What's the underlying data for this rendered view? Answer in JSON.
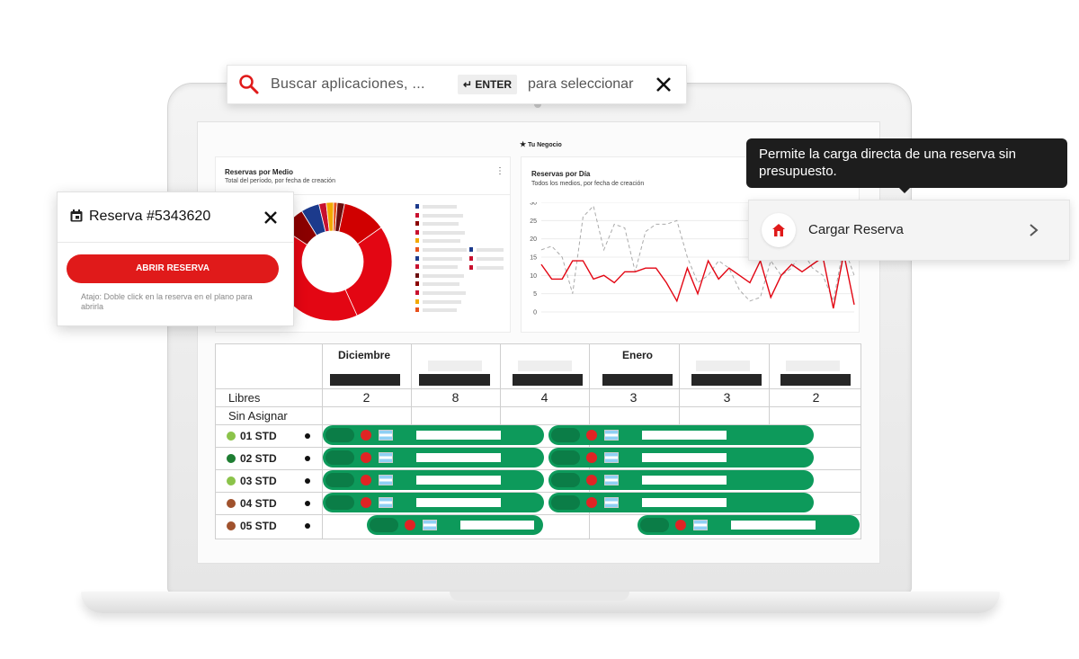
{
  "search": {
    "placeholder": "Buscar aplicaciones, ...",
    "enter_label": "ENTER",
    "hint": "para seleccionar"
  },
  "dashboard": {
    "section_title": "Tu Negocio",
    "card1": {
      "title": "Reservas por Medio",
      "subtitle": "Total del período, por fecha de creación"
    },
    "card2": {
      "title": "Reservas por Día",
      "subtitle": "Todos los medios, por fecha de creación"
    }
  },
  "chart_data": [
    {
      "type": "pie",
      "title": "Reservas por Medio",
      "values": [
        5,
        2,
        2,
        1,
        2,
        12,
        28,
        41,
        7
      ],
      "colors": [
        "#1c3a8c",
        "#c8102e",
        "#f2a900",
        "#e8501c",
        "#6b0d0d",
        "#d00000",
        "#e30613",
        "#e30613",
        "#8b0000"
      ]
    },
    {
      "type": "line",
      "title": "Reservas por Día",
      "ylim": [
        0,
        30
      ],
      "yticks": [
        0,
        5,
        10,
        15,
        20,
        25,
        30
      ],
      "series": [
        {
          "values": [
            13,
            9,
            9,
            14,
            14,
            9,
            10,
            8,
            11,
            11,
            12,
            12,
            8,
            3,
            12,
            5,
            14,
            9,
            12,
            10,
            8,
            14,
            4,
            10,
            13,
            11,
            13,
            15,
            1,
            16,
            2
          ],
          "color": "#e30613"
        },
        {
          "values": [
            17,
            18,
            15,
            5,
            26,
            29,
            17,
            24,
            23,
            11,
            22,
            24,
            24,
            25,
            15,
            8,
            10,
            14,
            12,
            6,
            3,
            4,
            14,
            10,
            12,
            17,
            12,
            10,
            3,
            18,
            10
          ],
          "color": "#aaaaaa"
        }
      ]
    }
  ],
  "table": {
    "months": [
      "Diciembre",
      "Enero"
    ],
    "libres_label": "Libres",
    "sin_asignar_label": "Sin Asignar",
    "libres_values": [
      "2",
      "8",
      "4",
      "3",
      "3",
      "2"
    ],
    "rooms": [
      {
        "name": "01 STD",
        "color": "#8bc34a"
      },
      {
        "name": "02 STD",
        "color": "#1e7d32"
      },
      {
        "name": "03 STD",
        "color": "#8bc34a"
      },
      {
        "name": "04 STD",
        "color": "#a0522d"
      },
      {
        "name": "05 STD",
        "color": "#a0522d"
      }
    ]
  },
  "reserva": {
    "title": "Reserva #5343620",
    "button": "ABRIR RESERVA",
    "hint": "Atajo: Doble click en la reserva en el plano para abrirla"
  },
  "tooltip": {
    "text": "Permite la carga directa de una reserva sin presupuesto."
  },
  "cargar": {
    "label": "Cargar Reserva"
  },
  "colors": {
    "accent": "#e01a1a",
    "booking": "#0d9a5b"
  }
}
